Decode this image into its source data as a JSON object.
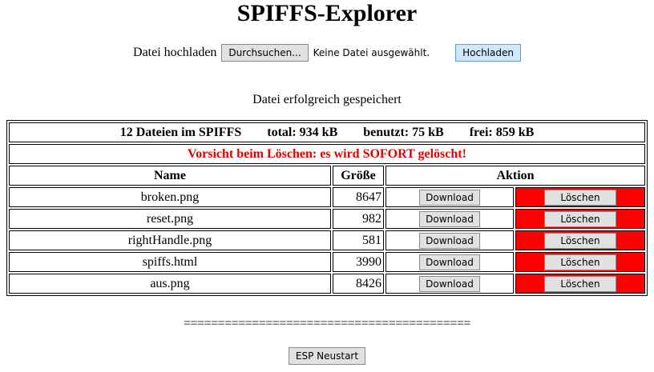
{
  "page": {
    "title": "SPIFFS-Explorer"
  },
  "upload": {
    "label": "Datei hochladen",
    "browse_button": "Durchsuchen...",
    "no_file_text": "Keine Datei ausgewählt.",
    "upload_button": "Hochladen"
  },
  "status_message": "Datei erfolgreich gespeichert",
  "summary": {
    "file_count": "12 Dateien im SPIFFS",
    "total": "total: 934 kB",
    "used": "benutzt: 75 kB",
    "free": "frei: 859 kB"
  },
  "warning": "Vorsicht beim Löschen: es wird SOFORT gelöscht!",
  "table": {
    "headers": {
      "name": "Name",
      "size": "Größe",
      "action": "Aktion"
    },
    "rows": [
      {
        "name": "broken.png",
        "size": "8647",
        "download": "Download",
        "delete": "Löschen"
      },
      {
        "name": "reset.png",
        "size": "982",
        "download": "Download",
        "delete": "Löschen"
      },
      {
        "name": "rightHandle.png",
        "size": "581",
        "download": "Download",
        "delete": "Löschen"
      },
      {
        "name": "spiffs.html",
        "size": "3990",
        "download": "Download",
        "delete": "Löschen"
      },
      {
        "name": "aus.png",
        "size": "8426",
        "download": "Download",
        "delete": "Löschen"
      }
    ]
  },
  "separator": "==========================================",
  "restart_button": "ESP  Neustart",
  "colors": {
    "warning_text": "#e00000",
    "delete_cell_bg": "#ff0000",
    "upload_button_bg": "#cfe8fb"
  }
}
